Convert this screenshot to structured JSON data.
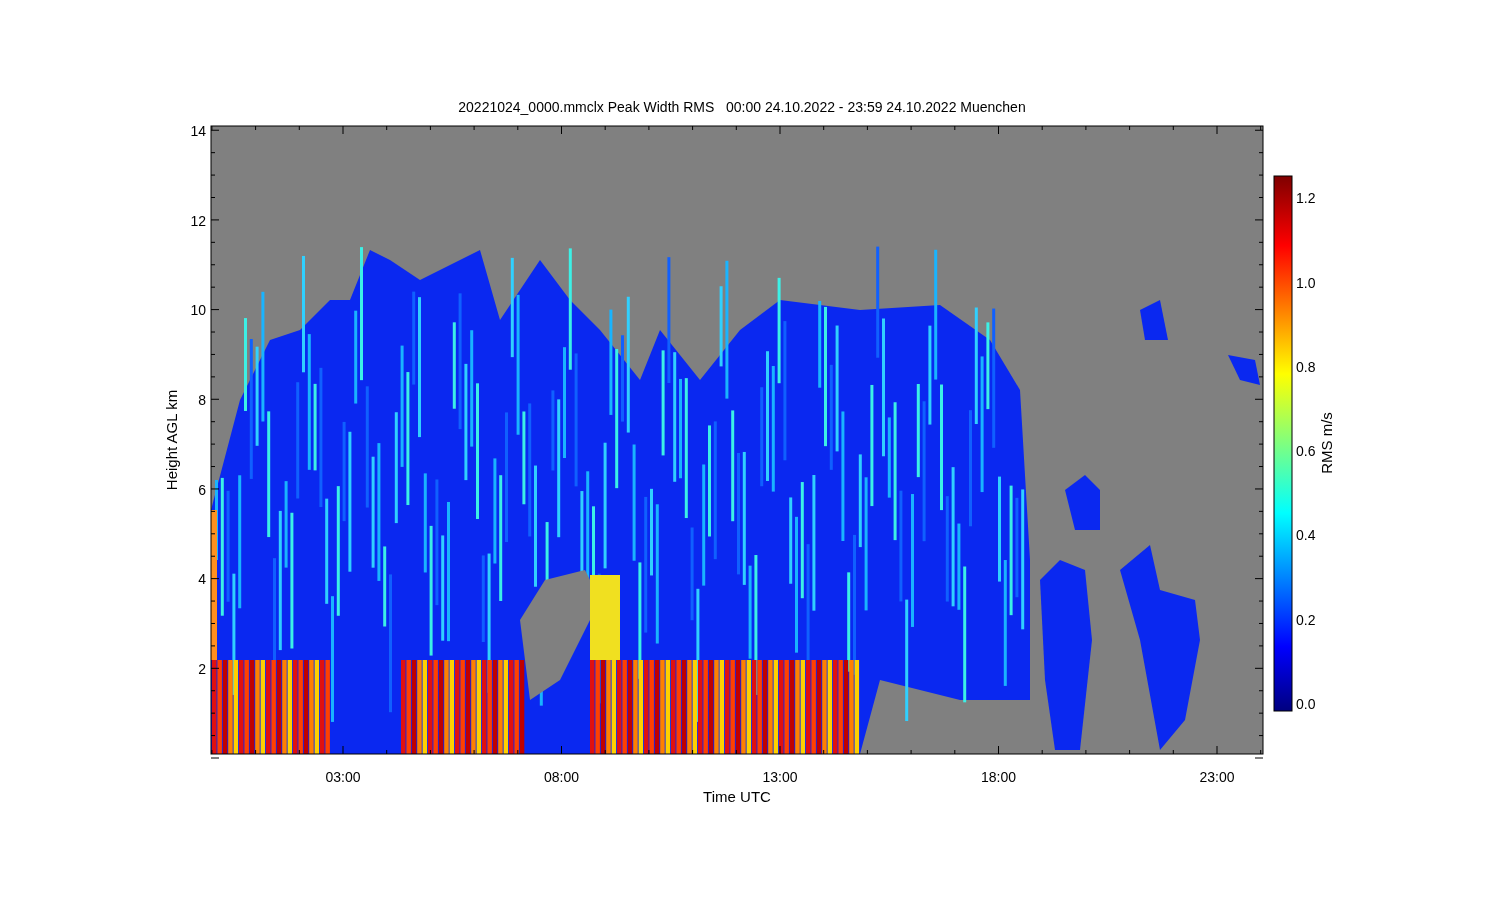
{
  "title": "20221024_0000.mmclx Peak Width RMS   00:00 24.10.2022 - 23:59 24.10.2022 Muenchen",
  "plot": {
    "xlabel": "Time UTC",
    "ylabel": "Height AGL km",
    "xticks": [
      "03:00",
      "08:00",
      "13:00",
      "18:00",
      "23:00"
    ],
    "yticks": [
      "14",
      "12",
      "10",
      "8",
      "6",
      "4",
      "2"
    ]
  },
  "colorbar": {
    "label": "RMS m/s",
    "ticks": [
      "1.2",
      "1.0",
      "0.8",
      "0.6",
      "0.4",
      "0.2",
      "0.0"
    ]
  }
}
